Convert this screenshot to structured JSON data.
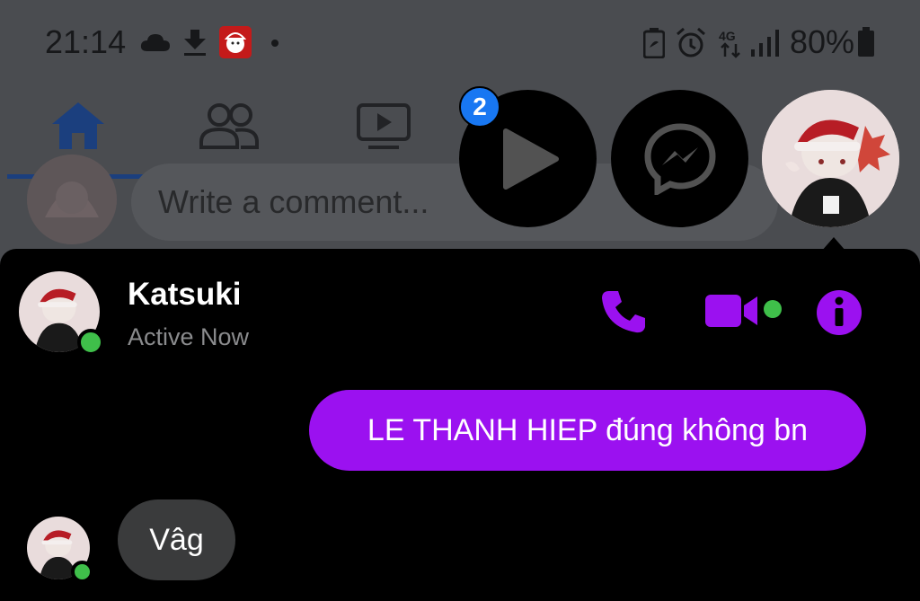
{
  "status_bar": {
    "time": "21:14",
    "battery_percent": "80%",
    "network": "4G",
    "left_icons": [
      "cloud-icon",
      "download-icon",
      "santa-app-icon",
      "dot-icon"
    ],
    "right_icons": [
      "battery-saver-icon",
      "alarm-icon",
      "signal-icon",
      "battery-icon"
    ]
  },
  "fb_nav": {
    "tabs": [
      "home-icon",
      "friends-icon",
      "watch-icon"
    ],
    "active_tab": "home"
  },
  "comment_bar": {
    "placeholder": "Write a comment..."
  },
  "chat_heads": {
    "video_badge_count": "2",
    "items": [
      "video-chat-head",
      "messenger-chat-head",
      "katsuki-chat-head"
    ]
  },
  "chat": {
    "contact_name": "Katsuki",
    "contact_status": "Active Now",
    "accent_color": "#9b11f0",
    "online_color": "#3fbf4a",
    "actions": [
      "phone-icon",
      "video-call-icon",
      "info-icon"
    ],
    "messages": [
      {
        "direction": "outgoing",
        "text": "LE THANH HIEP đúng không bn"
      },
      {
        "direction": "incoming",
        "text": "Vâg"
      }
    ]
  }
}
